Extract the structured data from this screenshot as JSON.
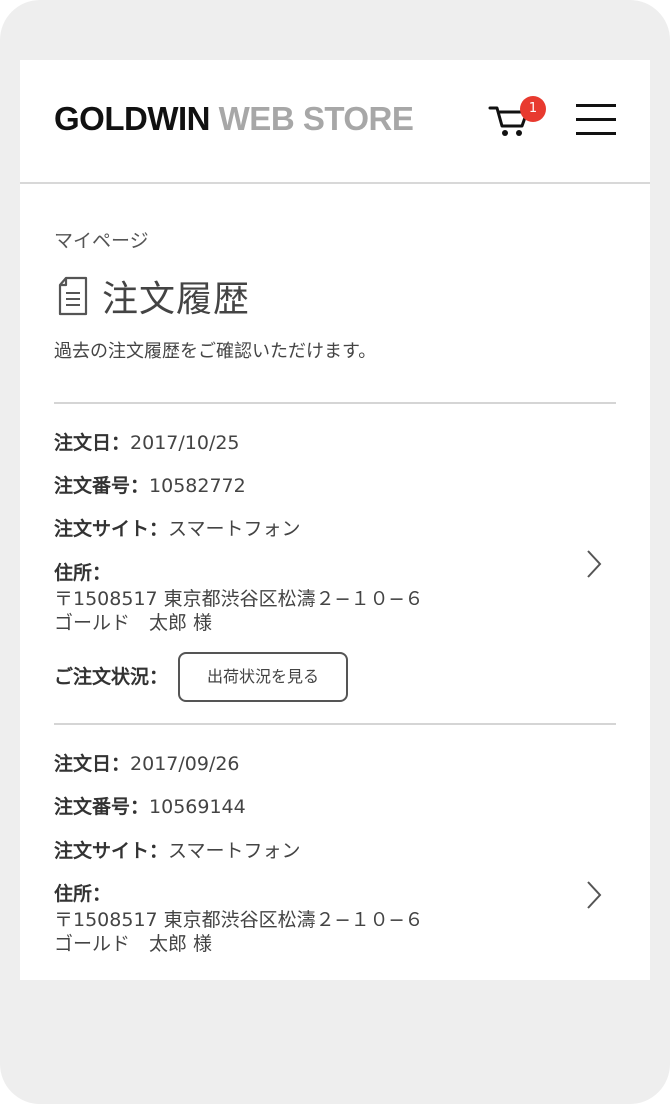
{
  "header": {
    "logo_primary": "GOLDWIN",
    "logo_secondary": "WEB STORE",
    "cart_count": "1"
  },
  "page": {
    "breadcrumb": "マイページ",
    "title": "注文履歴",
    "description": "過去の注文履歴をご確認いただけます。"
  },
  "labels": {
    "order_date": "注文日：",
    "order_number": "注文番号：",
    "order_site": "注文サイト：",
    "address": "住所：",
    "order_status": "ご注文状況："
  },
  "orders": [
    {
      "date": "2017/10/25",
      "number": "10582772",
      "site": "スマートフォン",
      "address_line1": "〒1508517 東京都渋谷区松濤２−１０−６",
      "address_line2": "ゴールド　太郎 様",
      "status_button": "出荷状況を見る"
    },
    {
      "date": "2017/09/26",
      "number": "10569144",
      "site": "スマートフォン",
      "address_line1": "〒1508517 東京都渋谷区松濤２−１０−６",
      "address_line2": "ゴールド　太郎 様"
    }
  ],
  "colors": {
    "badge": "#e83a2f",
    "logo_dark": "#111111",
    "logo_light": "#a7a7a7"
  },
  "icons": {
    "cart": "cart-icon",
    "menu": "hamburger-menu-icon",
    "title": "document-icon",
    "row": "chevron-right-icon"
  }
}
